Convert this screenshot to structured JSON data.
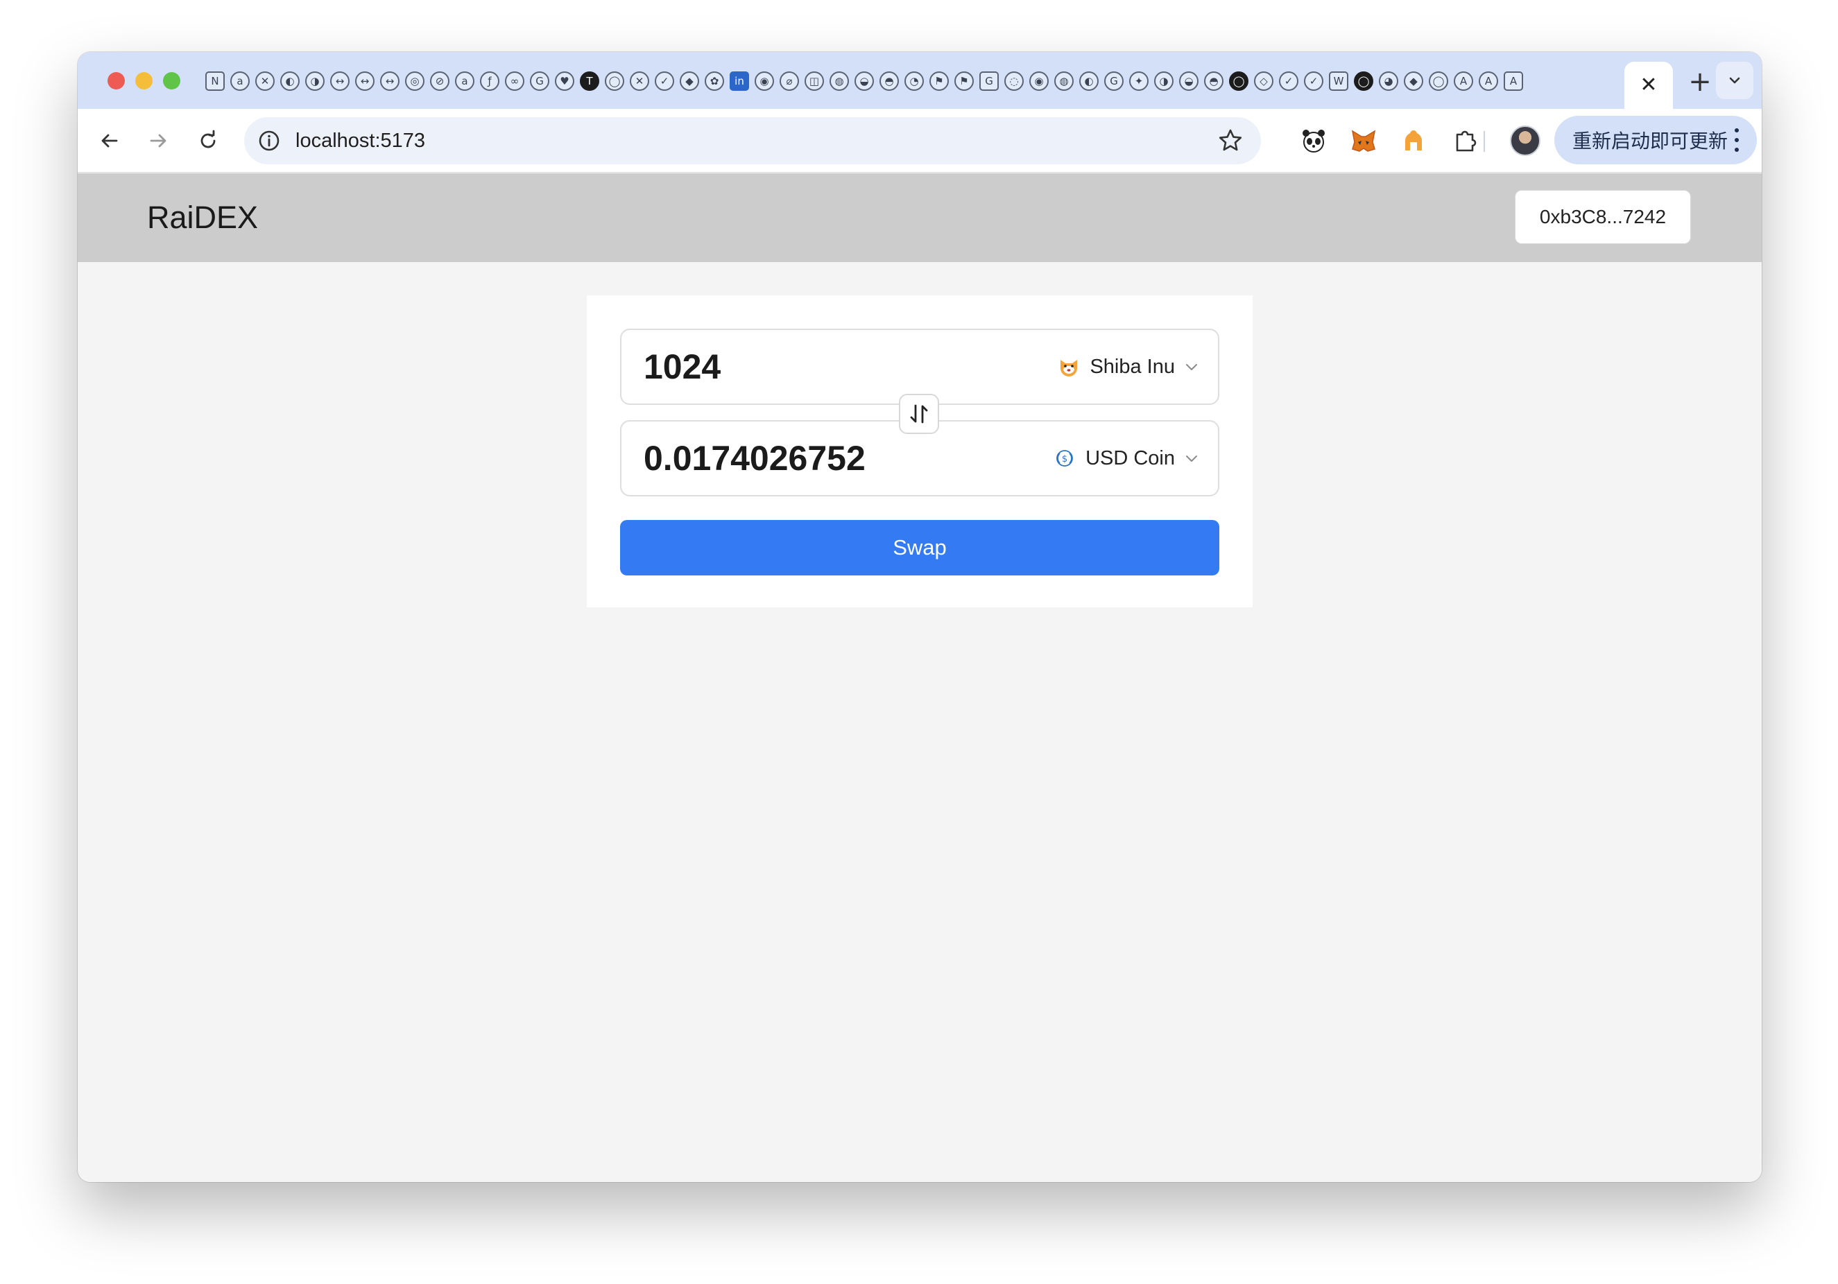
{
  "browser": {
    "active_tab_close": "✕",
    "new_tab": "+",
    "tab_search": "⌄",
    "url": "localhost:5173",
    "update_button_label": "重新启动即可更新",
    "pinned_tabs": [
      {
        "glyph": "N",
        "style": "sq"
      },
      {
        "glyph": "a",
        "style": ""
      },
      {
        "glyph": "✕",
        "style": ""
      },
      {
        "glyph": "◐",
        "style": ""
      },
      {
        "glyph": "◑",
        "style": ""
      },
      {
        "glyph": "↔",
        "style": ""
      },
      {
        "glyph": "↔",
        "style": ""
      },
      {
        "glyph": "↔",
        "style": ""
      },
      {
        "glyph": "◎",
        "style": ""
      },
      {
        "glyph": "⊘",
        "style": ""
      },
      {
        "glyph": "a",
        "style": ""
      },
      {
        "glyph": "ƒ",
        "style": ""
      },
      {
        "glyph": "∞",
        "style": ""
      },
      {
        "glyph": "G",
        "style": ""
      },
      {
        "glyph": "♥",
        "style": ""
      },
      {
        "glyph": "T",
        "style": "dark"
      },
      {
        "glyph": "◯",
        "style": ""
      },
      {
        "glyph": "✕",
        "style": ""
      },
      {
        "glyph": "✓",
        "style": ""
      },
      {
        "glyph": "◆",
        "style": ""
      },
      {
        "glyph": "✿",
        "style": ""
      },
      {
        "glyph": "in",
        "style": "blue"
      },
      {
        "glyph": "◉",
        "style": ""
      },
      {
        "glyph": "⌀",
        "style": ""
      },
      {
        "glyph": "◫",
        "style": ""
      },
      {
        "glyph": "◍",
        "style": ""
      },
      {
        "glyph": "◒",
        "style": ""
      },
      {
        "glyph": "◓",
        "style": ""
      },
      {
        "glyph": "◔",
        "style": ""
      },
      {
        "glyph": "⚑",
        "style": ""
      },
      {
        "glyph": "⚑",
        "style": ""
      },
      {
        "glyph": "G",
        "style": "sq"
      },
      {
        "glyph": "◌",
        "style": ""
      },
      {
        "glyph": "◉",
        "style": ""
      },
      {
        "glyph": "◍",
        "style": ""
      },
      {
        "glyph": "◐",
        "style": ""
      },
      {
        "glyph": "G",
        "style": ""
      },
      {
        "glyph": "✦",
        "style": ""
      },
      {
        "glyph": "◑",
        "style": ""
      },
      {
        "glyph": "◒",
        "style": ""
      },
      {
        "glyph": "◓",
        "style": ""
      },
      {
        "glyph": "◯",
        "style": "dark"
      },
      {
        "glyph": "◇",
        "style": ""
      },
      {
        "glyph": "✓",
        "style": ""
      },
      {
        "glyph": "✓",
        "style": ""
      },
      {
        "glyph": "W",
        "style": "sq"
      },
      {
        "glyph": "◯",
        "style": "dark"
      },
      {
        "glyph": "◕",
        "style": ""
      },
      {
        "glyph": "◆",
        "style": ""
      },
      {
        "glyph": "◯",
        "style": ""
      },
      {
        "glyph": "A",
        "style": ""
      },
      {
        "glyph": "A",
        "style": ""
      },
      {
        "glyph": "A",
        "style": "sq"
      }
    ]
  },
  "app": {
    "brand": "RaiDEX",
    "wallet_address": "0xb3C8...7242"
  },
  "swap": {
    "from": {
      "amount": "1024",
      "token": "Shiba Inu",
      "icon": "shiba-inu-icon"
    },
    "to": {
      "amount": "0.0174026752",
      "token": "USD Coin",
      "icon": "usd-coin-icon"
    },
    "button_label": "Swap"
  },
  "colors": {
    "accent": "#347af3",
    "header_bg": "#cccccc",
    "page_bg": "#f4f4f4",
    "tabstrip_bg": "#d3e0f8"
  }
}
